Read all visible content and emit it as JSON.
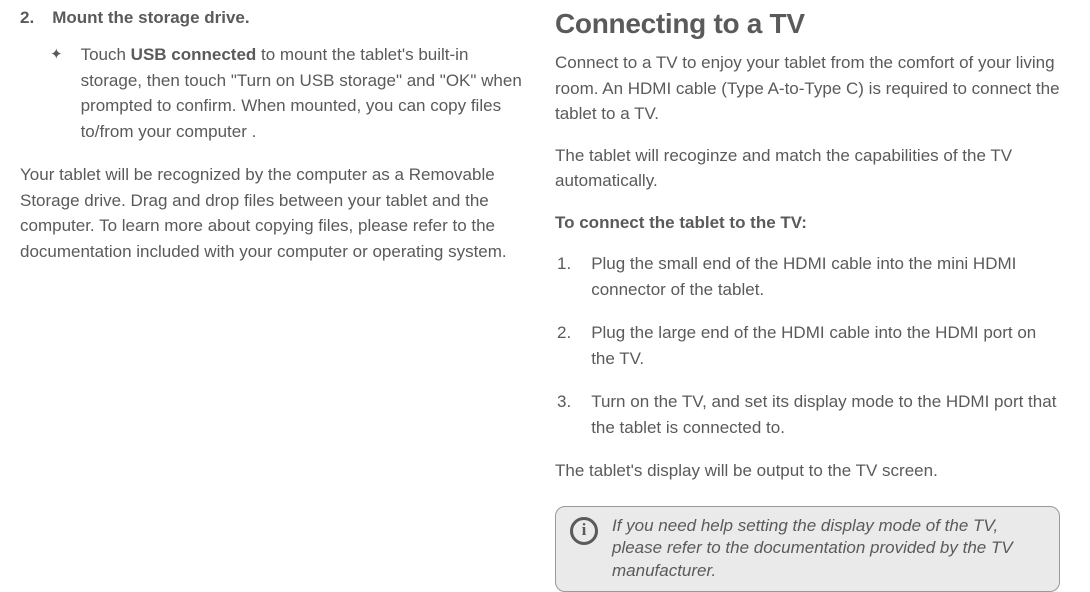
{
  "left": {
    "step_number": "2.",
    "step_title": "Mount the storage drive.",
    "bullet_marker": "✦",
    "bullet_prefix": "Touch ",
    "bullet_bold": "USB connected",
    "bullet_suffix": " to mount the tablet's  built-in storage, then touch \"Turn on USB storage\" and \"OK\" when prompted to confirm. When mounted, you can copy files to/from your computer .",
    "paragraph": "Your tablet will be recognized by the computer as a Removable Storage drive. Drag and drop files between your tablet and the computer. To learn more about copying files, please refer to the documentation included with your computer or operating system."
  },
  "right": {
    "heading": "Connecting to a TV",
    "intro": "Connect to a TV to enjoy your tablet from the comfort of your living room. An HDMI cable (Type A-to-Type C) is required to connect the tablet to a TV.",
    "auto": "The tablet will recoginze and match the capabilities of the TV automatically.",
    "connect_heading": "To connect the tablet to the TV:",
    "steps": [
      {
        "num": "1.",
        "text": "Plug the small end of the HDMI cable into the mini HDMI connector of the tablet."
      },
      {
        "num": "2.",
        "text": "Plug the large end of the HDMI cable into the HDMI port on the TV."
      },
      {
        "num": "3.",
        "text": "Turn on the TV, and set its display mode to the HDMI port that the tablet is connected to."
      }
    ],
    "output": "The tablet's display will be output to the TV screen.",
    "info_icon": "i",
    "info_text": "If you need help setting the display mode of the TV, please refer to the documentation provided by the TV manufacturer."
  }
}
